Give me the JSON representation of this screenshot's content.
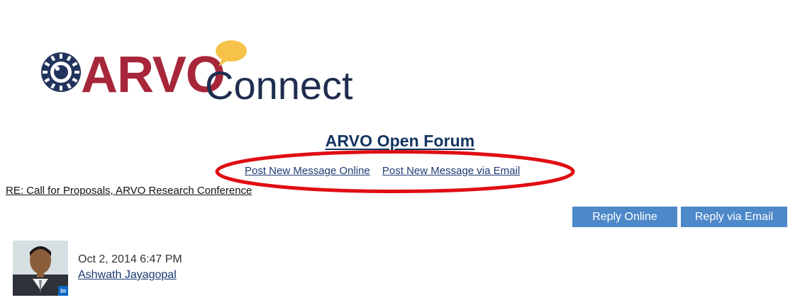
{
  "logo": {
    "text_arvo": "ARVO",
    "text_connect": "Connect"
  },
  "forum": {
    "title": "ARVO Open Forum"
  },
  "post_links": {
    "online_label": "Post New Message Online",
    "email_label": "Post New Message via Email"
  },
  "thread": {
    "title": "RE: Call for Proposals, ARVO Research Conference"
  },
  "actions": {
    "reply_online_label": "Reply Online",
    "reply_email_label": "Reply via Email"
  },
  "post": {
    "date": "Oct 2, 2014 6:47 PM",
    "author": "Ashwath Jayagopal",
    "badge": "in"
  },
  "colors": {
    "arvo_red": "#a7263a",
    "navy": "#1f2d4f",
    "bubble": "#f6c24a",
    "button_blue": "#4d88c9",
    "ellipse_red": "#e00d13"
  }
}
